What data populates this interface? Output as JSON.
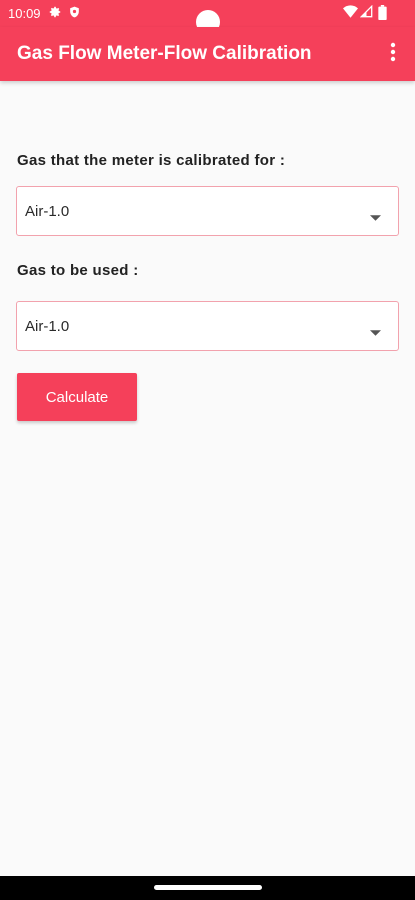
{
  "status_bar": {
    "time": "10:09",
    "icons": [
      "gear-icon",
      "shield-icon",
      "wifi-icon",
      "signal-icon",
      "battery-icon"
    ]
  },
  "app_bar": {
    "title": "Gas Flow Meter-Flow Calibration",
    "menu_icon": "more-vert-icon"
  },
  "form": {
    "calibrated_gas_label": "Gas that the meter is calibrated for :",
    "calibrated_gas_value": "Air-1.0",
    "used_gas_label": "Gas to be used :",
    "used_gas_value": "Air-1.0",
    "calculate_label": "Calculate"
  },
  "colors": {
    "accent": "#f5405a",
    "background": "#fafafa",
    "field_border": "#f2a2ad"
  }
}
